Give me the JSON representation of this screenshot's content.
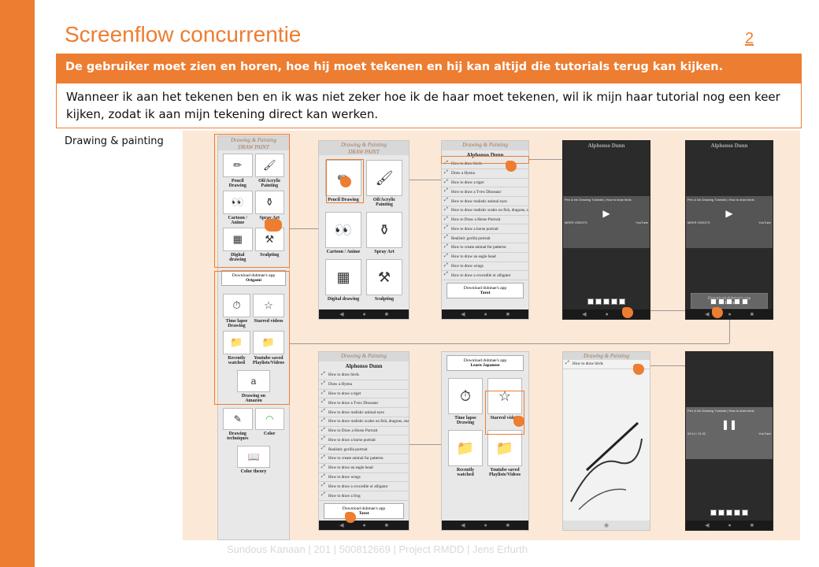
{
  "slide": {
    "title": "Screenflow concurrentie",
    "page_number": "2",
    "header": "De gebruiker moet zien en horen, hoe hij moet tekenen en hij kan altijd die tutorials terug kan kijken.",
    "description": "Wanneer ik aan het tekenen ben en ik was niet zeker hoe  ik de haar moet tekenen, wil ik mijn haar tutorial nog een keer kijken, zodat ik aan mijn tekening direct kan werken.",
    "section_label": "Drawing & painting",
    "footer": "Sundous Kanaan | 201 | 500812669 | Project RMDD | Jens Erfurth"
  },
  "app": {
    "header": "Drawing & Painting",
    "subheader": "DRAW PAINT",
    "categories": [
      "Pencil Drawing",
      "Oil/Acrylic Painting",
      "Cartoon / Anime",
      "Spray Art",
      "Digital drawing",
      "Sculpting"
    ],
    "more_categories": [
      "Time lapse Drawing",
      "Starred videos",
      "Recently watched",
      "Youtube saved Playlists/Videos",
      "Drawing on Amazon",
      "Drawing techniques",
      "Color",
      "Color theory"
    ],
    "promo_origami": {
      "line1": "Download duhmae's app",
      "line2": "Origami"
    },
    "promo_tarot": {
      "line1": "Download duhmae's app",
      "line2": "Tarot"
    },
    "promo_japanese": {
      "line1": "Download duhmae's app",
      "line2": "Learn Japanese"
    },
    "channel": "Alphonso Dunn",
    "tutorials": [
      "How to draw birds",
      "Draw a Hyena",
      "How to draw a tiger",
      "How to draw a T-rex Dinosaur",
      "How to draw realistic animal eyes",
      "How to draw realistic scales on fish, dragons, snakes, reptiles",
      "How to Draw a Horse Portrait",
      "How to draw a horse portrait",
      "Realistic gorilla portrait",
      "How to create animal fur patterns",
      "How to draw an eagle head",
      "How to draw wings",
      "How to draw a crocodile or alligator",
      "How to draw a frog"
    ],
    "video_title": "Pen & Ink Drawing Tutorials | How to draw birds",
    "video_time": "00:14 / 11:32",
    "more_videos": "MEER VIDEO'S",
    "youtube": "YouTube",
    "single_item": "How to draw birds"
  },
  "icons": [
    "hand-pointer-icon",
    "play-icon",
    "pause-icon",
    "back-icon",
    "home-icon",
    "star-icon"
  ],
  "colors": {
    "accent": "#ed7d31",
    "canvas": "#fce8d6"
  }
}
